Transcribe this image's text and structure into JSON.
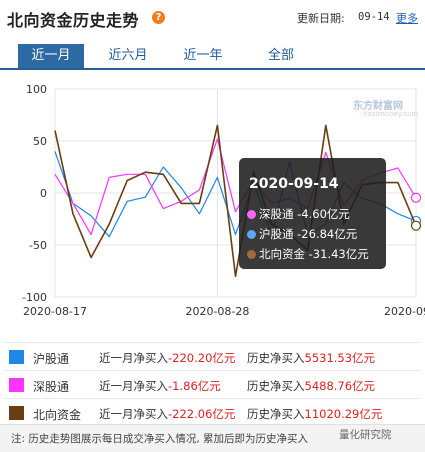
{
  "header": {
    "title": "北向资金历史走势",
    "help_icon": "?",
    "update_label": "更新日期:",
    "update_date": "09-14",
    "more_label": "更多"
  },
  "tabs": [
    {
      "label": "近一月",
      "active": true
    },
    {
      "label": "近六月",
      "active": false
    },
    {
      "label": "近一年",
      "active": false
    },
    {
      "label": "全部",
      "active": false
    }
  ],
  "watermark": {
    "logo": "东方财富网",
    "url": "eastmoney.com",
    "wechat": "量化研究院"
  },
  "tooltip": {
    "date": "2020-09-14",
    "rows": [
      {
        "name": "深股通",
        "value": "-4.60亿元",
        "color": "#ff66ff"
      },
      {
        "name": "沪股通",
        "value": "-26.84亿元",
        "color": "#5da5f5"
      },
      {
        "name": "北向资金",
        "value": "-31.43亿元",
        "color": "#9e6b3f"
      }
    ]
  },
  "chart_data": {
    "type": "line",
    "x": [
      "2020-08-17",
      "2020-08-18",
      "2020-08-19",
      "2020-08-20",
      "2020-08-21",
      "2020-08-24",
      "2020-08-25",
      "2020-08-26",
      "2020-08-27",
      "2020-08-28",
      "2020-08-31",
      "2020-09-01",
      "2020-09-02",
      "2020-09-03",
      "2020-09-04",
      "2020-09-07",
      "2020-09-08",
      "2020-09-09",
      "2020-09-10",
      "2020-09-11",
      "2020-09-14"
    ],
    "x_tick_labels": [
      "2020-08-17",
      "2020-08-28",
      "2020-09-14"
    ],
    "ylim": [
      -100,
      100
    ],
    "y_ticks": [
      100,
      50,
      0,
      -50,
      -100
    ],
    "grid": true,
    "series": [
      {
        "name": "沪股通",
        "color": "#1e88e5",
        "values": [
          40,
          -10,
          -22,
          -42,
          -8,
          -4,
          25,
          5,
          -20,
          15,
          -40,
          10,
          -40,
          30,
          -40,
          -30,
          10,
          -5,
          -10,
          -20,
          -26.84
        ]
      },
      {
        "name": "深股通",
        "color": "#ff33ff",
        "values": [
          18,
          -10,
          -40,
          15,
          18,
          18,
          -15,
          -8,
          3,
          52,
          -18,
          12,
          -10,
          -5,
          -15,
          39,
          -12,
          12,
          19,
          24,
          -4.6
        ]
      },
      {
        "name": "北向资金",
        "color": "#6b3d12",
        "values": [
          60,
          -20,
          -62,
          -30,
          12,
          20,
          18,
          -10,
          -10,
          65,
          -80,
          20,
          -30,
          -40,
          -55,
          65,
          -30,
          8,
          10,
          10,
          -31.43
        ]
      }
    ]
  },
  "legend": [
    {
      "name": "沪股通",
      "color": "#1e88e5",
      "month_label": "近一月净买入",
      "month_value": "-220.20亿元",
      "hist_label": "历史净买入",
      "hist_value": "5531.53亿元"
    },
    {
      "name": "深股通",
      "color": "#ff33ff",
      "month_label": "近一月净买入",
      "month_value": "-1.86亿元",
      "hist_label": "历史净买入",
      "hist_value": "5488.76亿元"
    },
    {
      "name": "北向资金",
      "color": "#6b3d12",
      "month_label": "近一月净买入",
      "month_value": "-222.06亿元",
      "hist_label": "历史净买入",
      "hist_value": "11020.29亿元"
    }
  ],
  "note": "注: 历史走势图展示每日成交净买入情况, 累加后即为历史净买入"
}
